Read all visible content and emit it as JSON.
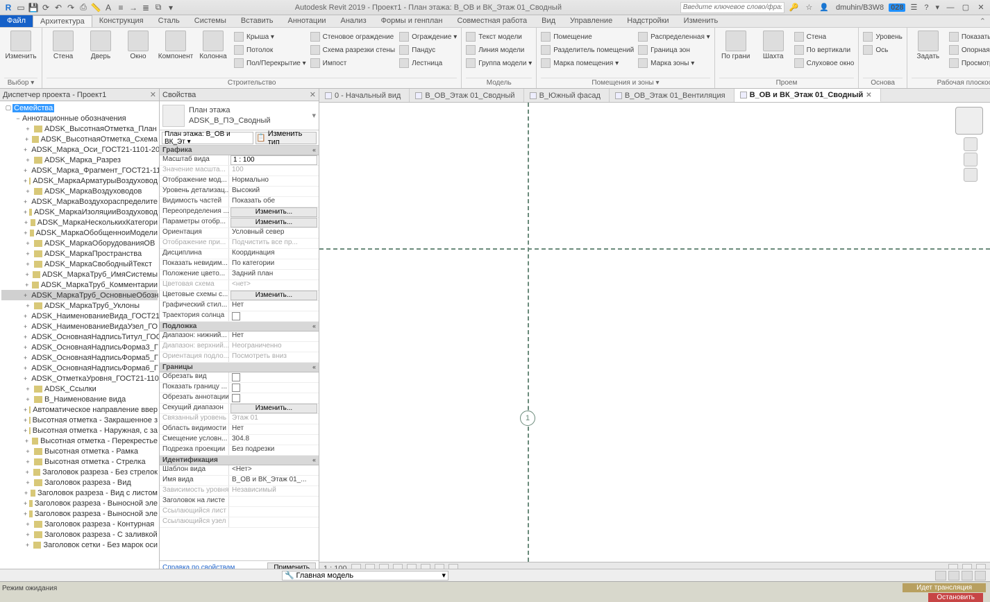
{
  "title": "Autodesk Revit 2019 - Проект1 - План этажа: В_ОВ и ВК_Этаж 01_Сводный",
  "qat_icons": [
    "revit-logo-icon",
    "open-icon",
    "save-icon",
    "sync-icon",
    "undo-icon",
    "redo-icon",
    "measure-icon",
    "text-icon",
    "section-icon",
    "thin-lines-icon",
    "close-icon",
    "switch-icon",
    "dropdown-icon"
  ],
  "search_placeholder": "Введите ключевое слово/фразу",
  "top_right": {
    "user": "dmuhin/B3W8",
    "badge": "028",
    "help": "?"
  },
  "file_tab": "Файл",
  "ribbon_tabs": [
    "Архитектура",
    "Конструкция",
    "Сталь",
    "Системы",
    "Вставить",
    "Аннотации",
    "Анализ",
    "Формы и генплан",
    "Совместная работа",
    "Вид",
    "Управление",
    "Надстройки",
    "Изменить"
  ],
  "active_tab_index": 0,
  "ribbon": {
    "panel0": {
      "big": [
        "Изменить"
      ],
      "title": "Выбор ▾"
    },
    "panel1": {
      "big": [
        "Стена",
        "Дверь",
        "Окно",
        "Компонент",
        "Колонна"
      ],
      "stack": [
        [
          "Крыша ▾",
          "Потолок",
          "Пол/Перекрытие ▾"
        ],
        [
          "Стеновое ограждение",
          "Схема разрезки стены",
          "Импост"
        ],
        [
          "Ограждение ▾",
          "Пандус",
          "Лестница"
        ]
      ],
      "title": "Строительство"
    },
    "panel2": {
      "stack": [
        [
          "Текст модели",
          "Линия модели",
          "Группа модели ▾"
        ]
      ],
      "title": "Модель"
    },
    "panel3": {
      "stack": [
        [
          "Помещение",
          "Разделитель помещений",
          "Марка помещения ▾"
        ],
        [
          "Распределенная ▾",
          "Граница зон",
          "Марка зоны ▾"
        ]
      ],
      "title": "Помещения и зоны ▾"
    },
    "panel4": {
      "big": [
        "По грани",
        "Шахта"
      ],
      "stack": [
        [
          "Стена",
          "По вертикали",
          "Слуховое окно"
        ]
      ],
      "title": "Проем"
    },
    "panel5": {
      "stack": [
        [
          "Уровень",
          "Ось"
        ]
      ],
      "title": "Основа"
    },
    "panel6": {
      "big": [
        "Задать"
      ],
      "stack": [
        [
          "Показать",
          "Опорная плоскость",
          "Просмотр"
        ]
      ],
      "title": "Рабочая плоскость"
    }
  },
  "browser": {
    "title": "Диспетчер проекта - Проект1",
    "root": "Семейства",
    "group": "Аннотационные обозначения",
    "items": [
      "ADSK_ВысотнаяОтметка_План",
      "ADSK_ВысотнаяОтметка_Схема",
      "ADSK_Марка_Оси_ГОСТ21-1101-20",
      "ADSK_Марка_Разрез",
      "ADSK_Марка_Фрагмент_ГОСТ21-11",
      "ADSK_МаркаАрматурыВоздуховод",
      "ADSK_МаркаВоздуховодов",
      "ADSK_МаркаВоздухораспределите",
      "ADSK_МаркаИзоляцииВоздуховод",
      "ADSK_МаркаНесколькихКатегори",
      "ADSK_МаркаОбобщенноиМодели",
      "ADSK_МаркаОборудованияОВ",
      "ADSK_МаркаПространства",
      "ADSK_МаркаСвободныйТекст",
      "ADSK_МаркаТруб_ИмяСистемы",
      "ADSK_МаркаТруб_Комментарии",
      "ADSK_МаркаТруб_ОсновныеОбозначения",
      "ADSK_МаркаТруб_Уклоны",
      "ADSK_НаименованиеВида_ГОСТ21",
      "ADSK_НаименованиеВидаУзел_ГО",
      "ADSK_ОсновнаяНадписьТитул_ГОС",
      "ADSK_ОсновнаяНадписьФорма3_Г",
      "ADSK_ОсновнаяНадписьФорма5_Г",
      "ADSK_ОсновнаяНадписьФорма6_Г",
      "ADSK_ОтметкаУровня_ГОСТ21-110",
      "ADSK_Ссылки",
      "В_Наименование вида",
      "Автоматическое направление ввер",
      "Высотная отметка - Закрашенное з",
      "Высотная отметка - Наружная, с за",
      "Высотная отметка - Перекрестье",
      "Высотная отметка - Рамка",
      "Высотная отметка - Стрелка",
      "Заголовок разреза - Без стрелок",
      "Заголовок разреза - Вид",
      "Заголовок разреза - Вид с листом",
      "Заголовок разреза - Выносной эле",
      "Заголовок разреза - Выносной эле",
      "Заголовок разреза - Контурная",
      "Заголовок разреза - С заливкой",
      "Заголовок сетки - Без марок оси"
    ],
    "highlighted_index": 16
  },
  "properties": {
    "title": "Свойства",
    "type_name_line1": "План этажа",
    "type_name_line2": "ADSK_В_ПЭ_Сводный",
    "instance_dd": "План этажа: В_ОВ и ВК_Эт ▾",
    "edit_type": "Изменить тип",
    "groups": [
      {
        "name": "Графика",
        "props": [
          {
            "k": "Масштаб вида",
            "v": "1 : 100",
            "input": true
          },
          {
            "k": "Значение масшта...",
            "v": "100",
            "disabled": true
          },
          {
            "k": "Отображение мод...",
            "v": "Нормально"
          },
          {
            "k": "Уровень детализац...",
            "v": "Высокий"
          },
          {
            "k": "Видимость частей",
            "v": "Показать обе"
          },
          {
            "k": "Переопределения ...",
            "btn": "Изменить..."
          },
          {
            "k": "Параметры отобр...",
            "btn": "Изменить..."
          },
          {
            "k": "Ориентация",
            "v": "Условный север"
          },
          {
            "k": "Отображение при...",
            "v": "Подчистить все пр...",
            "disabled": true
          },
          {
            "k": "Дисциплина",
            "v": "Координация"
          },
          {
            "k": "Показать невидим...",
            "v": "По категории"
          },
          {
            "k": "Положение цвето...",
            "v": "Задний план"
          },
          {
            "k": "Цветовая схема",
            "v": "<нет>",
            "disabled": true
          },
          {
            "k": "Цветовые схемы с...",
            "btn": "Изменить..."
          },
          {
            "k": "Графический стил...",
            "v": "Нет"
          },
          {
            "k": "Траектория солнца",
            "chk": true
          }
        ]
      },
      {
        "name": "Подложка",
        "props": [
          {
            "k": "Диапазон: нижний...",
            "v": "Нет"
          },
          {
            "k": "Диапазон: верхний...",
            "v": "Неограниченно",
            "disabled": true
          },
          {
            "k": "Ориентация подло...",
            "v": "Посмотреть вниз",
            "disabled": true
          }
        ]
      },
      {
        "name": "Границы",
        "props": [
          {
            "k": "Обрезать вид",
            "chk": true
          },
          {
            "k": "Показать границу ...",
            "chk": true
          },
          {
            "k": "Обрезать аннотации",
            "chk": true
          },
          {
            "k": "Секущий диапазон",
            "btn": "Изменить..."
          },
          {
            "k": "Связанный уровень",
            "v": "Этаж 01",
            "disabled": true
          },
          {
            "k": "Область видимости",
            "v": "Нет"
          },
          {
            "k": "Смещение условн...",
            "v": "304.8"
          },
          {
            "k": "Подрезка проекции",
            "v": "Без подрезки"
          }
        ]
      },
      {
        "name": "Идентификация",
        "props": [
          {
            "k": "Шаблон вида",
            "v": "<Нет>"
          },
          {
            "k": "Имя вида",
            "v": "В_ОВ и ВК_Этаж 01_..."
          },
          {
            "k": "Зависимость уровня",
            "v": "Независимый",
            "disabled": true
          },
          {
            "k": "Заголовок на листе",
            "v": ""
          },
          {
            "k": "Ссылающийся лист",
            "v": "",
            "disabled": true
          },
          {
            "k": "Ссылающийся узел",
            "v": "",
            "disabled": true
          }
        ]
      }
    ],
    "help_link": "Справка по свойствам",
    "apply": "Применить"
  },
  "view_tabs": [
    {
      "label": "0 - Начальный вид"
    },
    {
      "label": "В_ОВ_Этаж 01_Сводный"
    },
    {
      "label": "В_Южный фасад"
    },
    {
      "label": "В_ОВ_Этаж 01_Вентиляция"
    },
    {
      "label": "В_ОВ и ВК_Этаж 01_Сводный",
      "active": true
    }
  ],
  "grid_bubble": "1",
  "view_scale": "1 : 100",
  "status": "Режим ожидания",
  "workset_dd": "Главная модель",
  "broadcast": "Идет трансляция",
  "stop_btn": "Остановить"
}
